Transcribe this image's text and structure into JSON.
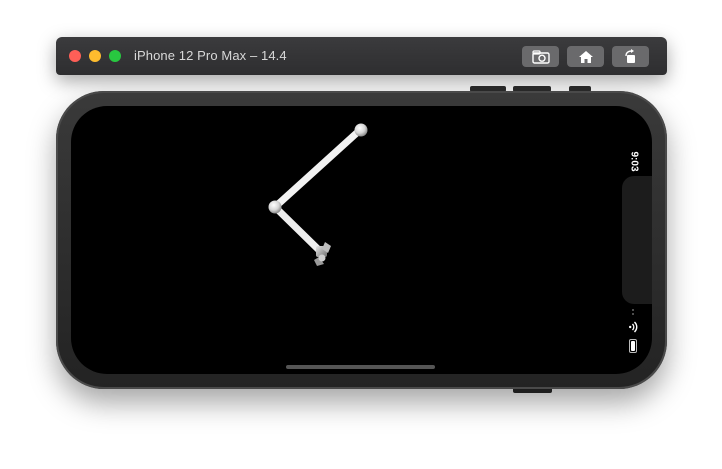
{
  "window": {
    "title": "iPhone 12 Pro Max – 14.4",
    "controls": {
      "close_color": "#fe5f57",
      "minimize_color": "#febc2e",
      "zoom_color": "#28c840"
    },
    "toolbar_buttons": [
      {
        "name": "screenshot",
        "icon": "camera-icon"
      },
      {
        "name": "home",
        "icon": "home-icon"
      },
      {
        "name": "rotate",
        "icon": "rotate-icon"
      }
    ]
  },
  "device": {
    "model": "iPhone 12 Pro Max",
    "orientation": "landscape"
  },
  "status_bar": {
    "time": "9:03",
    "icons": [
      "wifi-icon",
      "battery-icon"
    ]
  },
  "scene": {
    "description_colors": {
      "arm": "#f2f2f2",
      "joint": "#dcdcdc",
      "background": "#000000"
    }
  }
}
